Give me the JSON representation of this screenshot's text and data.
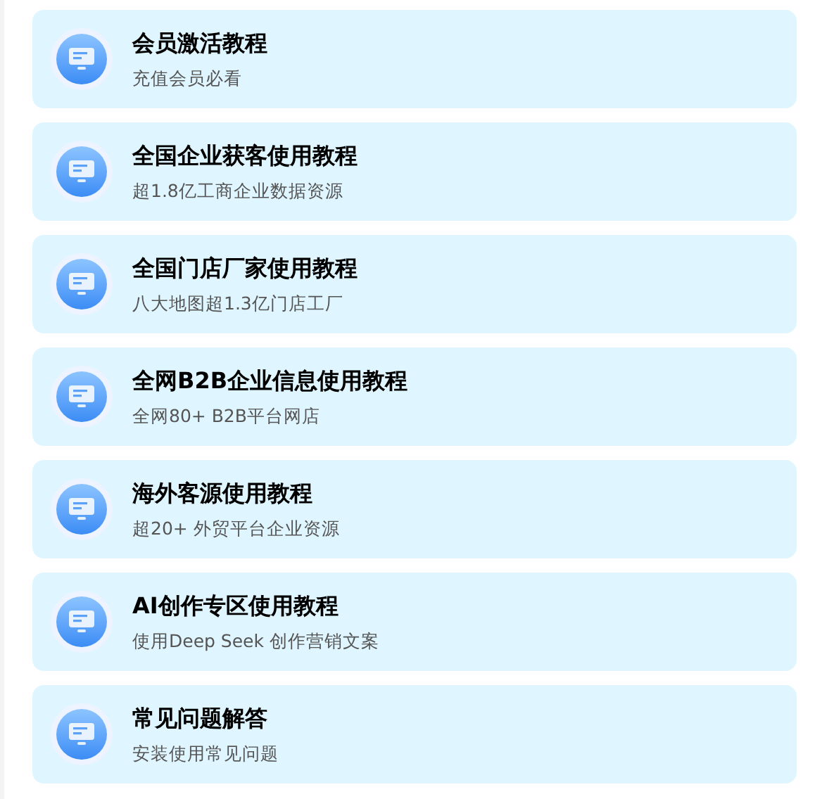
{
  "tutorials": [
    {
      "title": "会员激活教程",
      "subtitle": "充值会员必看"
    },
    {
      "title": "全国企业获客使用教程",
      "subtitle": "超1.8亿工商企业数据资源"
    },
    {
      "title": "全国门店厂家使用教程",
      "subtitle": "八大地图超1.3亿门店工厂"
    },
    {
      "title": "全网B2B企业信息使用教程",
      "subtitle": "全网80+ B2B平台网店"
    },
    {
      "title": "海外客源使用教程",
      "subtitle": "超20+ 外贸平台企业资源"
    },
    {
      "title": "AI创作专区使用教程",
      "subtitle": "使用Deep Seek 创作营销文案"
    },
    {
      "title": "常见问题解答",
      "subtitle": "安装使用常见问题"
    }
  ]
}
